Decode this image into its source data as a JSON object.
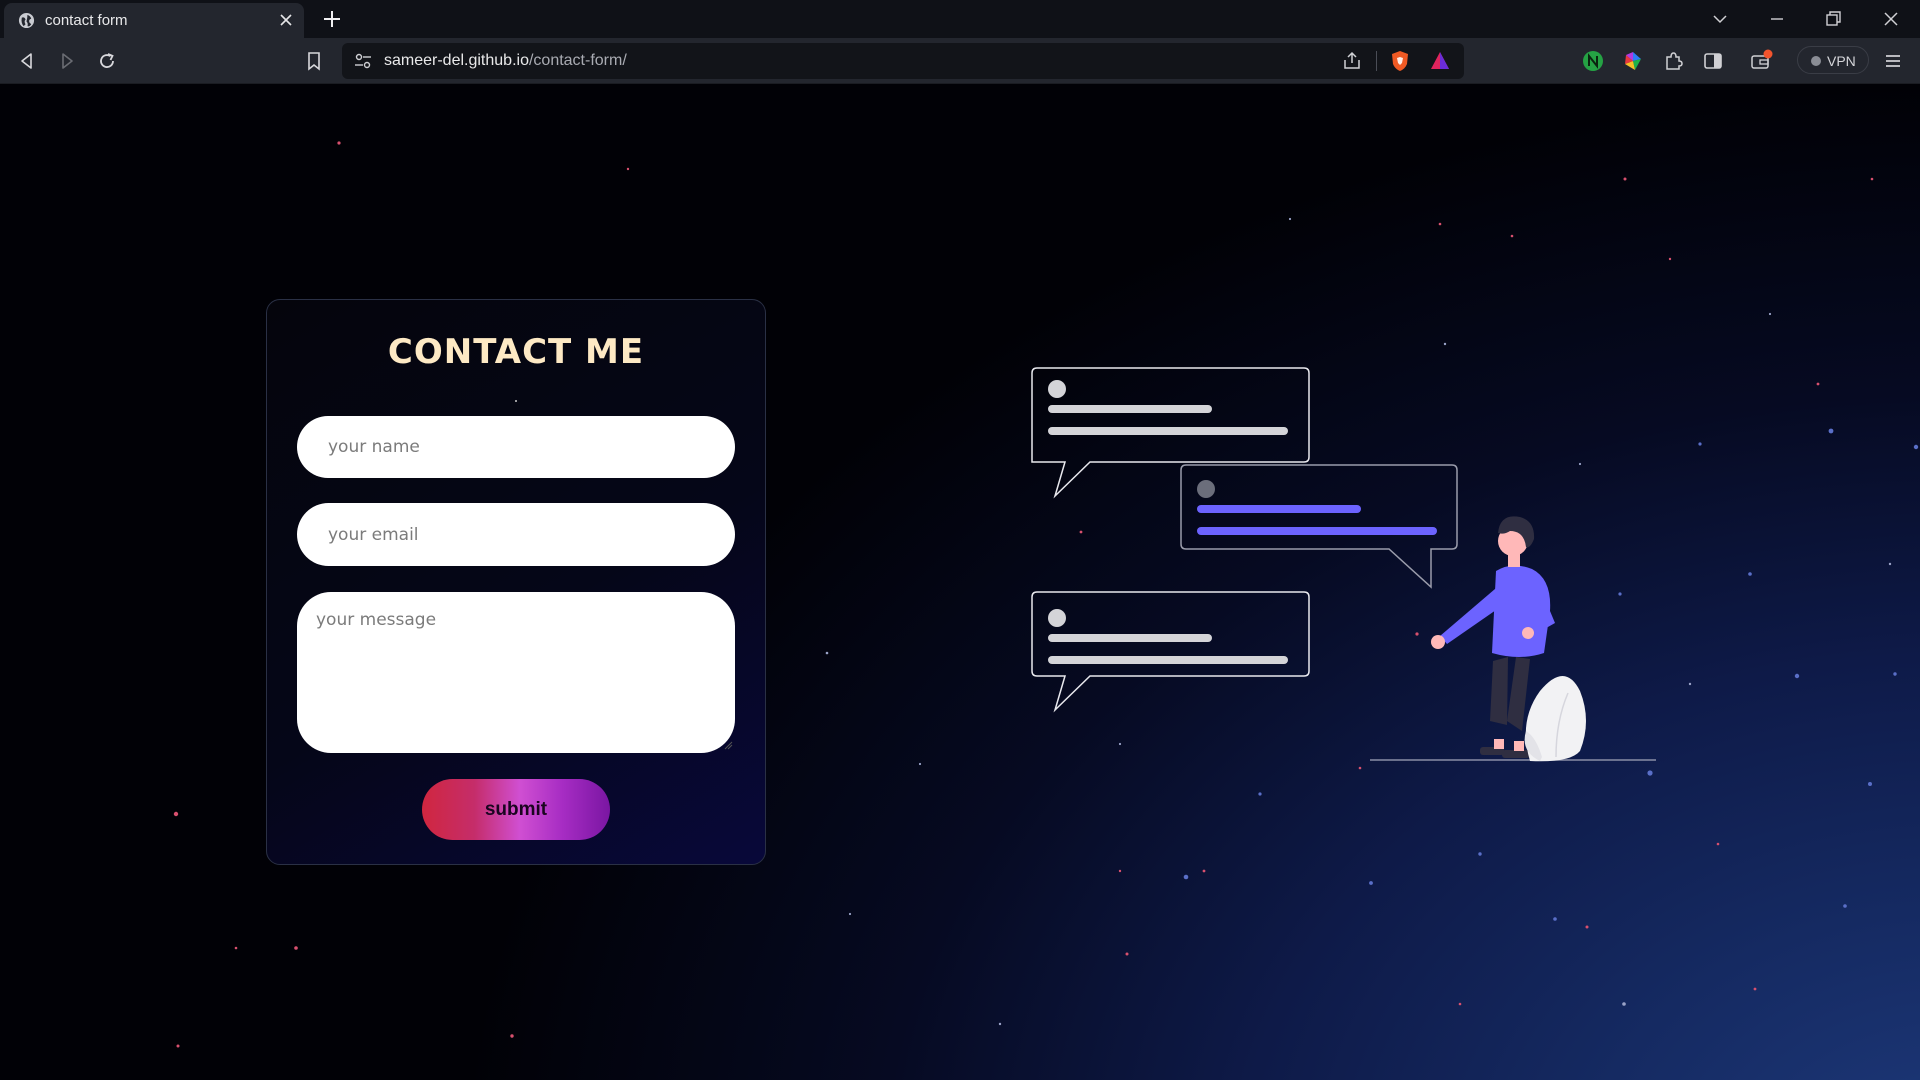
{
  "browser": {
    "tab": {
      "title": "contact form"
    },
    "url": {
      "host": "sameer-del.github.io",
      "path": "/contact-form/"
    },
    "vpn_label": "VPN"
  },
  "page": {
    "heading": "CONTACT ME",
    "form": {
      "name_placeholder": "your name",
      "email_placeholder": "your email",
      "message_placeholder": "your message",
      "submit_label": "submit"
    }
  },
  "colors": {
    "heading": "#fde9c4",
    "accent_purple": "#6c63ff",
    "bubble_line_gray": "#d4d4d8"
  }
}
